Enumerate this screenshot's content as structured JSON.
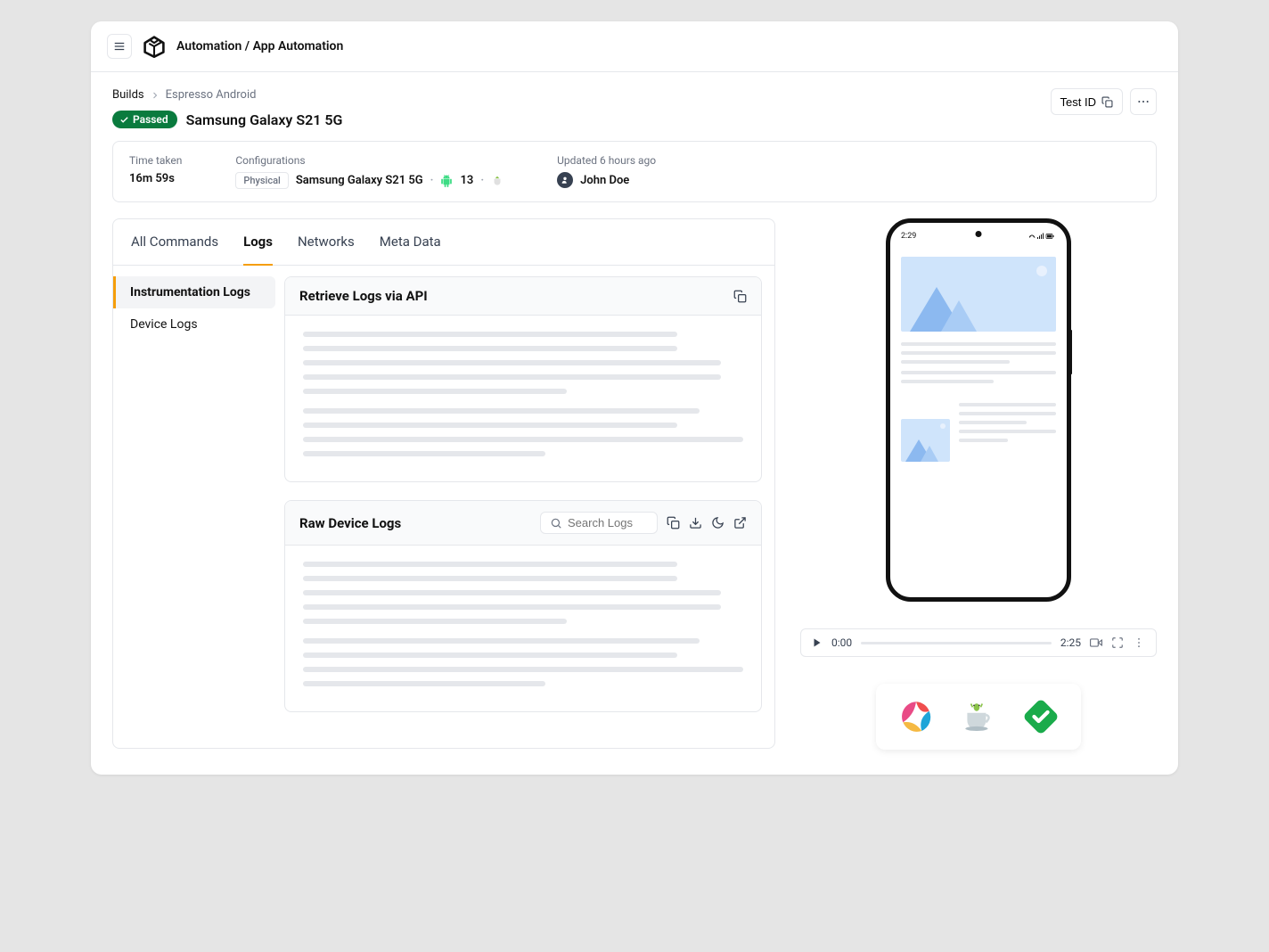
{
  "header": {
    "breadcrumb": "Automation / App Automation"
  },
  "crumbs": {
    "root": "Builds",
    "current": "Espresso Android"
  },
  "status": {
    "label": "Passed"
  },
  "title": "Samsung Galaxy S21 5G",
  "actions": {
    "test_id": "Test ID"
  },
  "info": {
    "time_label": "Time taken",
    "time_value": "16m 59s",
    "config_label": "Configurations",
    "config_tag": "Physical",
    "config_device": "Samsung Galaxy S21 5G",
    "config_os": "13",
    "updated_label": "Updated 6 hours ago",
    "user": "John Doe"
  },
  "tabs": [
    "All Commands",
    "Logs",
    "Networks",
    "Meta Data"
  ],
  "active_tab": "Logs",
  "nav": [
    "Instrumentation Logs",
    "Device Logs"
  ],
  "active_nav": "Instrumentation Logs",
  "cards": {
    "api": {
      "title": "Retrieve Logs via API"
    },
    "raw": {
      "title": "Raw Device Logs",
      "search_placeholder": "Search Logs"
    }
  },
  "phone": {
    "time": "2:29"
  },
  "player": {
    "start": "0:00",
    "end": "2:25"
  }
}
